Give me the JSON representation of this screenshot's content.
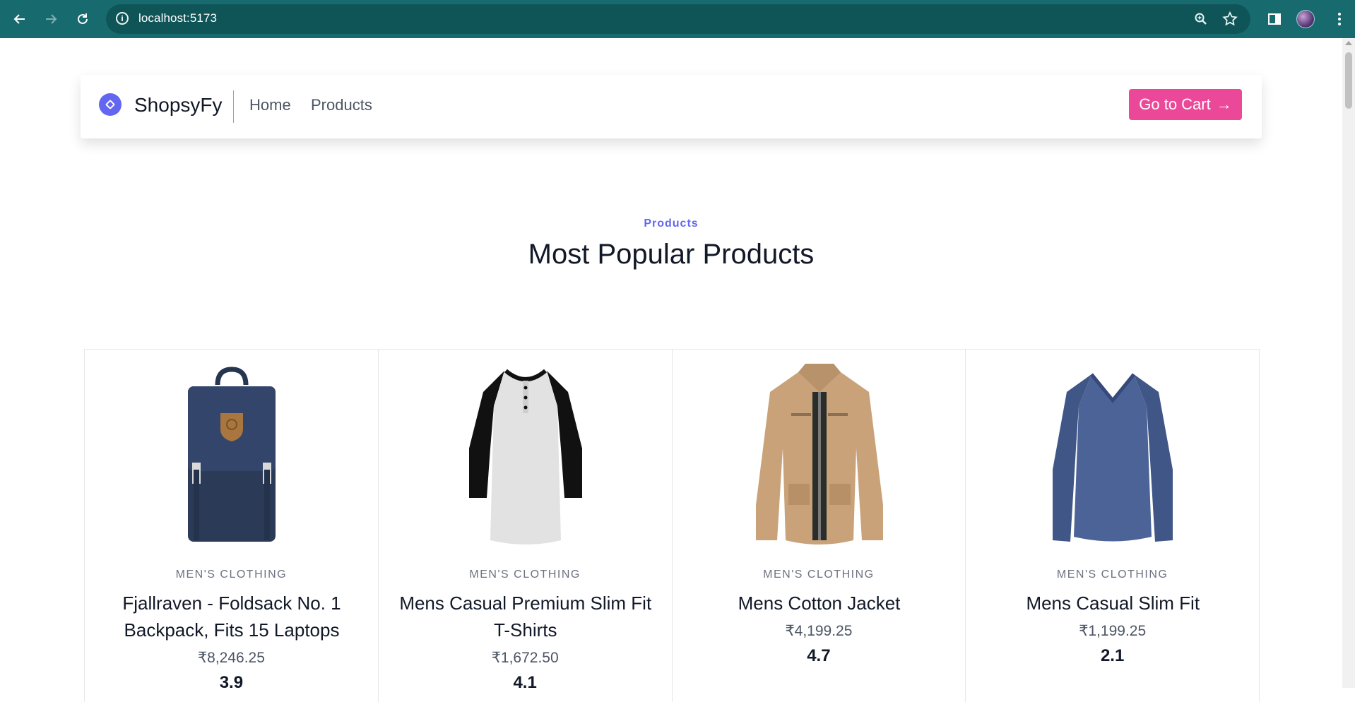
{
  "browser": {
    "url": "localhost:5173"
  },
  "header": {
    "brand": "ShopsyFy",
    "nav": [
      {
        "label": "Home"
      },
      {
        "label": "Products"
      }
    ],
    "cart_label": "Go to Cart",
    "cart_arrow": "→",
    "accent_color": "#ec4899",
    "brand_color": "#6366f1"
  },
  "section": {
    "eyebrow": "Products",
    "title": "Most Popular Products"
  },
  "products": [
    {
      "category": "MEN'S CLOTHING",
      "name": "Fjallraven - Foldsack No. 1 Backpack, Fits 15 Laptops",
      "price": "₹8,246.25",
      "rating": "3.9",
      "icon": "backpack-image"
    },
    {
      "category": "MEN'S CLOTHING",
      "name": "Mens Casual Premium Slim Fit T-Shirts",
      "price": "₹1,672.50",
      "rating": "4.1",
      "icon": "raglan-tshirt-image"
    },
    {
      "category": "MEN'S CLOTHING",
      "name": "Mens Cotton Jacket",
      "price": "₹4,199.25",
      "rating": "4.7",
      "icon": "jacket-image"
    },
    {
      "category": "MEN'S CLOTHING",
      "name": "Mens Casual Slim Fit",
      "price": "₹1,199.25",
      "rating": "2.1",
      "icon": "longsleeve-shirt-image"
    }
  ]
}
